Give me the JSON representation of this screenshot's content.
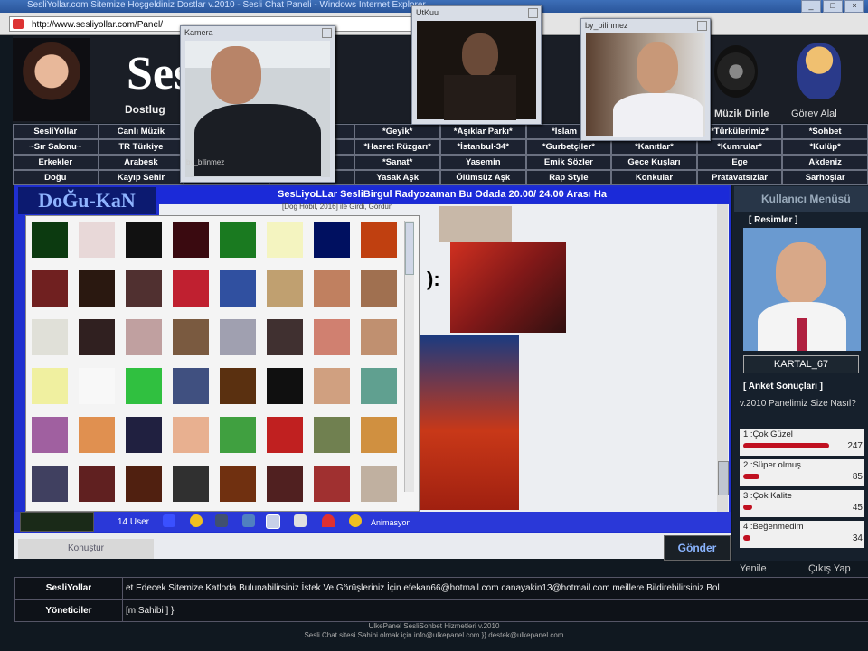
{
  "window": {
    "title": "SesliYollar.com Sitemize Hoşgeldiniz Dostlar v.2010 - Sesli Chat Paneli - Windows Internet Explorer",
    "address": "http://www.sesliyollar.com/Panel/"
  },
  "header": {
    "logo": "Sesli",
    "logo_sub": "Dostlug",
    "mp3_label": "Müzik Dinle",
    "gorev_label": "Görev Alal"
  },
  "nav": {
    "row1": [
      "SesliYollar",
      "Canlı Müzik",
      "",
      "",
      "*Geyik*",
      "*Aşıklar Parkı*",
      "*İslam N",
      "",
      "*Türkülerimiz*",
      "*Sohbet"
    ],
    "row2": [
      "~Sır Salonu~",
      "TR Türkiye",
      "",
      "",
      "*Hasret Rüzgarı*",
      "*İstanbul-34*",
      "*Gurbetçiler*",
      "*Kanıtlar*",
      "*Kumrular*",
      "*Kulüp*"
    ],
    "row3": [
      "Erkekler",
      "Arabesk",
      "",
      "",
      "*Sanat*",
      "Yasemin",
      "Emik Sözler",
      "Gece Kuşları",
      "Ege",
      "Akdeniz"
    ],
    "row4": [
      "Doğu",
      "Kayıp Sehir",
      "",
      "",
      "Yasak Aşk",
      "Ölümsüz Aşk",
      "Rap Style",
      "Konkular",
      "Pratavatsızlar",
      "Sarhoşlar"
    ]
  },
  "cams": [
    {
      "title": "Kamera",
      "caption": "by_bilinmez"
    },
    {
      "title": "UtKuu",
      "caption": ""
    },
    {
      "title": "by_bilinmez",
      "caption": ""
    }
  ],
  "chat": {
    "brand": "DoĞu-KaN",
    "header": "SesLiyoLLar SesliBirgul Radyozaman Bu Odada 20.00/ 24.00 Arası Ha",
    "subheader": "[Dog Hobil, 2016] ile Girdi, Gördün",
    "user_count": "14 User",
    "animasyon": "Animasyon",
    "send": "Gönder",
    "konustur": "Konuştur"
  },
  "sidebar": {
    "title": "Kullanıcı Menüsü",
    "resimler": "[ Resimler ]",
    "username": "KARTAL_67",
    "poll_title": "[ Anket Sonuçları ]",
    "poll_question": "v.2010 Panelimiz Size Nasıl?",
    "poll": [
      {
        "label": "1 :Çok Güzel",
        "count": "247",
        "share": 0.95
      },
      {
        "label": "2 :Süper olmuş",
        "count": "85",
        "share": 0.18
      },
      {
        "label": "3 :Çok Kalite",
        "count": "45",
        "share": 0.1
      },
      {
        "label": "4 :Beğenmedim",
        "count": "34",
        "share": 0.08
      }
    ],
    "yenile": "Yenile",
    "cikis": "Çıkış Yap"
  },
  "footer": {
    "row1_label": "SesliYollar",
    "row1_text": "et Edecek Sitemize Katloda Bulunabilirsiniz İstek Ve Görüşleriniz İçin efekan66@hotmail.com canayakin13@hotmail.com meillere Bildirebilirsiniz Bol",
    "row2_label": "Yöneticiler",
    "row2_text": "[m Sahibi ] }",
    "copy1": "UlkePanel SesliSohbet Hizmetleri v.2010",
    "copy2": "Sesli Chat sitesi Sahibi olmak için info@ulkepanel.com }} destek@ulkepanel.com"
  }
}
